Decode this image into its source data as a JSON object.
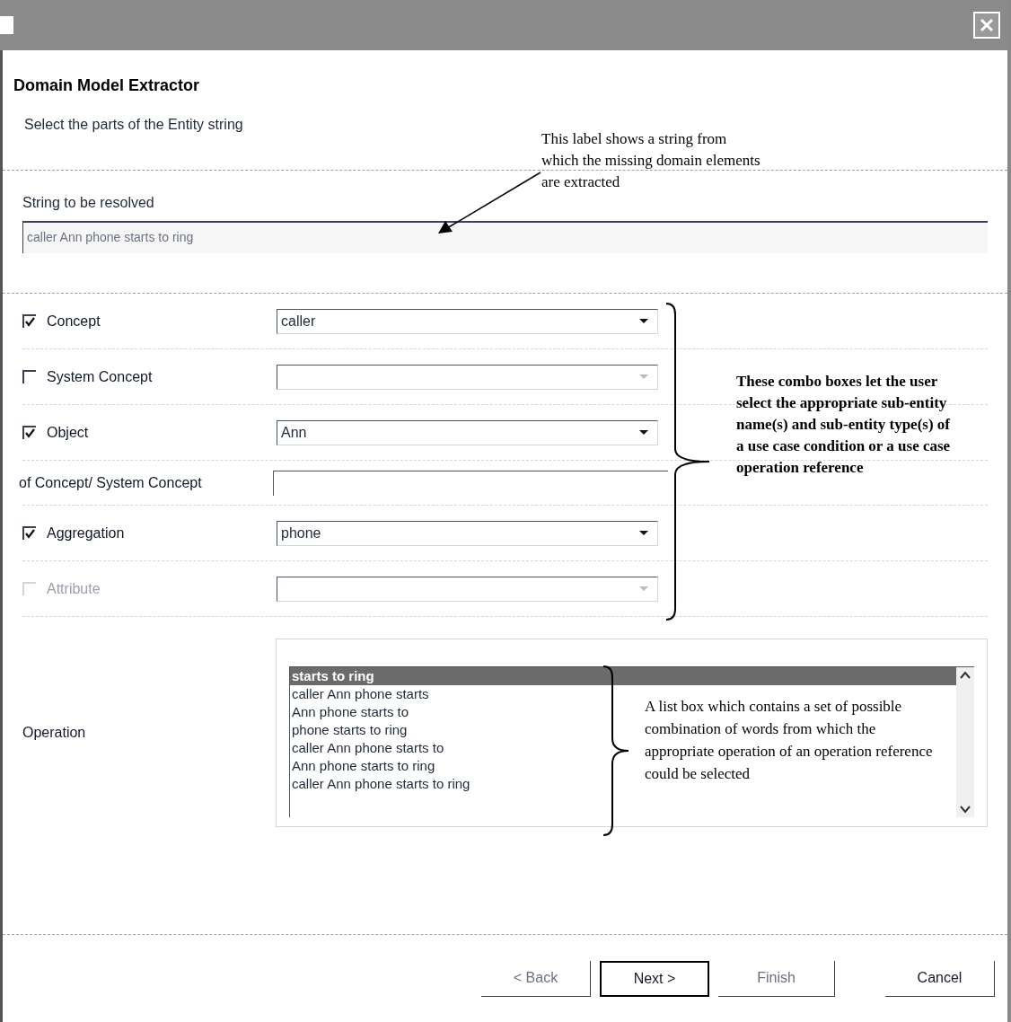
{
  "dialog": {
    "heading": "Domain Model Extractor",
    "subheading": "Select the parts of the Entity string"
  },
  "source": {
    "label": "String to be resolved",
    "value": "caller Ann phone starts to ring",
    "disabled": true
  },
  "fields": [
    {
      "kind": "combo",
      "label": "Concept",
      "checked": true,
      "disabled": false,
      "value": "caller"
    },
    {
      "kind": "combo",
      "label": "System Concept",
      "checked": false,
      "disabled": false
    },
    {
      "kind": "combo",
      "label": "Object",
      "checked": true,
      "disabled": false,
      "value": "Ann"
    },
    {
      "kind": "text",
      "label": "of Concept/ System Concept"
    },
    {
      "kind": "combo",
      "label": "Aggregation",
      "checked": true,
      "disabled": false,
      "value": "phone"
    },
    {
      "kind": "combo",
      "label": "Attribute",
      "checked": false,
      "disabled": true
    }
  ],
  "operation": {
    "label": "Operation",
    "items": [
      {
        "text": "starts to ring",
        "selected": true
      },
      {
        "text": "caller Ann phone starts",
        "selected": false
      },
      {
        "text": "Ann phone starts to",
        "selected": false
      },
      {
        "text": "phone starts to ring",
        "selected": false
      },
      {
        "text": "caller Ann phone starts to",
        "selected": false
      },
      {
        "text": "Ann phone starts to ring",
        "selected": false
      },
      {
        "text": "caller Ann phone starts to ring",
        "selected": false
      }
    ]
  },
  "buttons": [
    {
      "label": "< Back",
      "disabled": true,
      "default": false
    },
    {
      "label": "Next >",
      "disabled": false,
      "default": true
    },
    {
      "label": "Finish",
      "disabled": true,
      "default": false
    },
    {
      "label": "Cancel",
      "disabled": false,
      "default": false
    }
  ],
  "annotations": [
    {
      "text": "This label shows a string from which the missing domain elements are extracted"
    },
    {
      "text": "These combo boxes let the user select the appropriate sub-entity name(s) and sub-entity type(s) of a use case condition or a use case operation reference"
    },
    {
      "text": "A list box which contains a set of possible combination of words from which the appropriate operation of an operation reference could be selected"
    }
  ]
}
